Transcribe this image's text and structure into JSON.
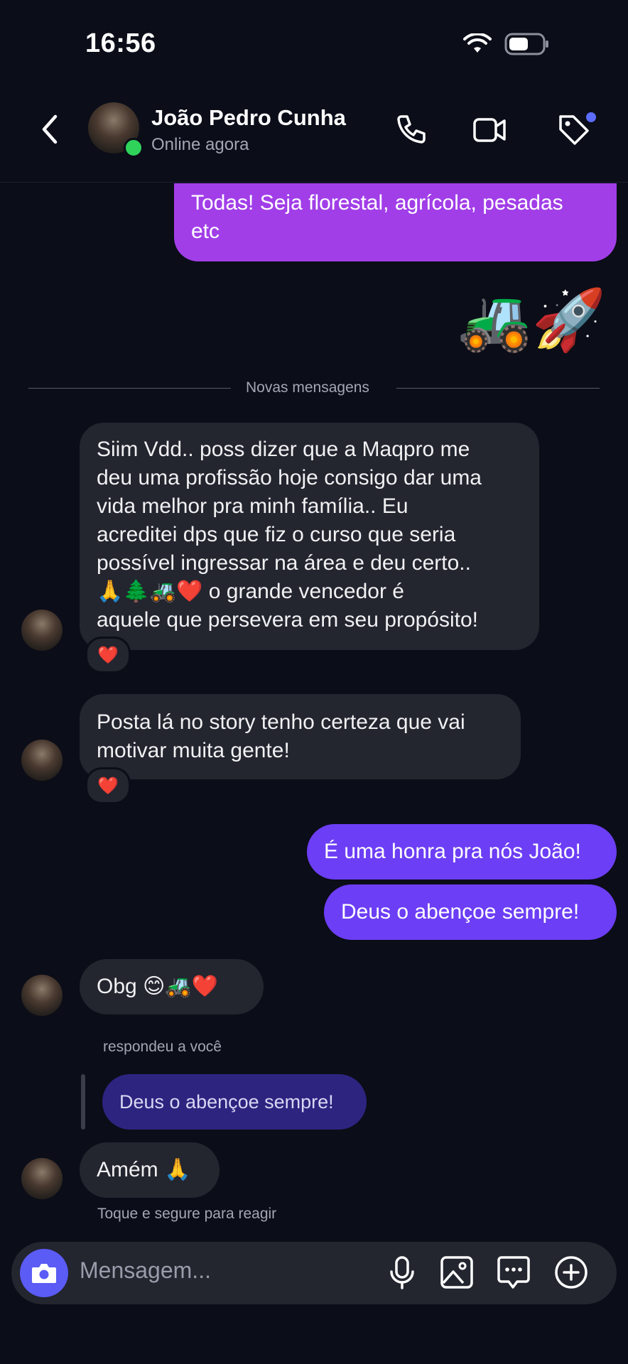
{
  "status_bar": {
    "time": "16:56"
  },
  "header": {
    "contact_name": "João Pedro Cunha",
    "status": "Online agora",
    "icons": [
      "back-icon",
      "phone-icon",
      "video-icon",
      "tag-icon"
    ]
  },
  "messages": {
    "m1": "Todas! Seja florestal, agrícola, pesadas",
    "m1b": "etc",
    "m2_emoji": "🚜🚀",
    "divider": "Novas mensagens",
    "m3_lines": [
      "Siim Vdd.. poss dizer que a Maqpro me",
      "deu uma profissão hoje consigo dar uma",
      "vida melhor pra minh família.. Eu",
      "acreditei dps que fiz o curso que seria",
      "possível ingressar na área e deu certo..",
      "🙏🌲🚜❤️ o grande vencedor é",
      "aquele que persevera em seu propósito!"
    ],
    "m3_reaction": "❤️",
    "m4_lines": [
      "Posta lá no story tenho certeza que vai",
      "motivar muita gente!"
    ],
    "m4_reaction": "❤️",
    "m5": "É uma honra pra nós João!",
    "m6": "Deus o abençoe sempre!",
    "m7": "Obg 😊🚜❤️",
    "reply_label": "respondeu a você",
    "reply_quote": "Deus o abençoe sempre!",
    "m8": "Amém 🙏",
    "hint": "Toque e segure para reagir"
  },
  "composer": {
    "placeholder": "Mensagem...",
    "icons": [
      "camera-icon",
      "microphone-icon",
      "gallery-icon",
      "sticker-icon",
      "plus-icon"
    ]
  },
  "colors": {
    "background": "#0b0d18",
    "sent_bubble": "#6c3ef5",
    "sent_bubble_gradient": "#a13ee8",
    "received_bubble": "#23252f",
    "online": "#2fd35a",
    "camera_button": "#5b5bf5"
  }
}
